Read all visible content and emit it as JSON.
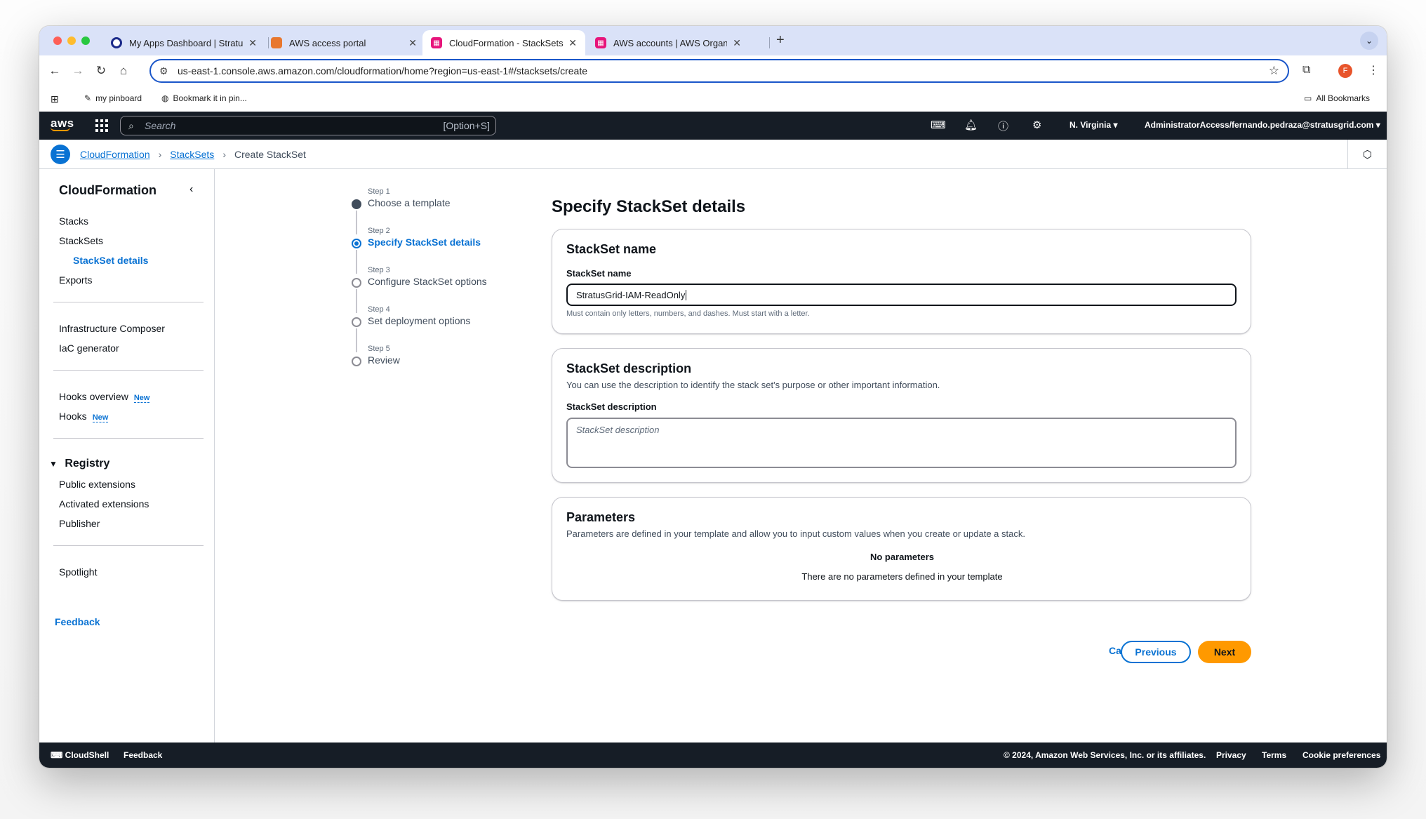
{
  "browser": {
    "tabs": [
      {
        "title": "My Apps Dashboard | StratusGrid",
        "favicon_color": "#1b2a8a",
        "favicon": "O"
      },
      {
        "title": "AWS access portal",
        "favicon_color": "#e8772e",
        "favicon": "◆"
      },
      {
        "title": "CloudFormation - StackSets",
        "favicon_color": "#e7157b",
        "favicon": "▦"
      },
      {
        "title": "AWS accounts | AWS Organizations",
        "favicon_color": "#e7157b",
        "favicon": "▦"
      }
    ],
    "url": "us-east-1.console.aws.amazon.com/cloudformation/home?region=us-east-1#/stacksets/create",
    "bookmarks": [
      {
        "label": "my pinboard"
      },
      {
        "label": "Bookmark it in pin..."
      }
    ],
    "all_bookmarks": "All Bookmarks",
    "profile_initial": "F"
  },
  "aws_nav": {
    "logo": "aws",
    "search_placeholder": "Search",
    "search_shortcut": "[Option+S]",
    "region": "N. Virginia",
    "account": "AdministratorAccess/fernando.pedraza@stratusgrid.com"
  },
  "breadcrumbs": [
    {
      "label": "CloudFormation"
    },
    {
      "label": "StackSets"
    },
    {
      "label": "Create StackSet"
    }
  ],
  "sidebar": {
    "title": "CloudFormation",
    "group1": [
      {
        "label": "Stacks"
      },
      {
        "label": "StackSets"
      },
      {
        "label": "StackSet details"
      },
      {
        "label": "Exports"
      }
    ],
    "group2": [
      {
        "label": "Infrastructure Composer"
      },
      {
        "label": "IaC generator"
      }
    ],
    "group3": [
      {
        "label": "Hooks overview",
        "badge": "New"
      },
      {
        "label": "Hooks",
        "badge": "New"
      }
    ],
    "registry": {
      "label": "Registry",
      "items": [
        {
          "label": "Public extensions"
        },
        {
          "label": "Activated extensions"
        },
        {
          "label": "Publisher"
        }
      ]
    },
    "spotlight": "Spotlight",
    "feedback": "Feedback"
  },
  "wizard": {
    "steps": [
      {
        "step": "Step 1",
        "name": "Choose a template",
        "state": "done"
      },
      {
        "step": "Step 2",
        "name": "Specify StackSet details",
        "state": "current"
      },
      {
        "step": "Step 3",
        "name": "Configure StackSet options",
        "state": "pending"
      },
      {
        "step": "Step 4",
        "name": "Set deployment options",
        "state": "pending"
      },
      {
        "step": "Step 5",
        "name": "Review",
        "state": "pending"
      }
    ]
  },
  "page": {
    "title": "Specify StackSet details",
    "name_card": {
      "heading": "StackSet name",
      "field_label": "StackSet name",
      "value": "StratusGrid-IAM-ReadOnly",
      "hint": "Must contain only letters, numbers, and dashes. Must start with a letter."
    },
    "desc_card": {
      "heading": "StackSet description",
      "description": "You can use the description to identify the stack set's purpose or other important information.",
      "field_label": "StackSet description",
      "placeholder": "StackSet description"
    },
    "params_card": {
      "heading": "Parameters",
      "description": "Parameters are defined in your template and allow you to input custom values when you create or update a stack.",
      "empty_title": "No parameters",
      "empty_text": "There are no parameters defined in your template"
    },
    "actions": {
      "cancel": "Cancel",
      "previous": "Previous",
      "next": "Next"
    }
  },
  "footer": {
    "cloudshell": "CloudShell",
    "feedback": "Feedback",
    "copyright": "© 2024, Amazon Web Services, Inc. or its affiliates.",
    "privacy": "Privacy",
    "terms": "Terms",
    "cookies": "Cookie preferences"
  },
  "colors": {
    "aws_nav": "#161d26",
    "link": "#0972d3",
    "primary_button": "#ff9900",
    "tabstrip": "#dae2f8"
  }
}
